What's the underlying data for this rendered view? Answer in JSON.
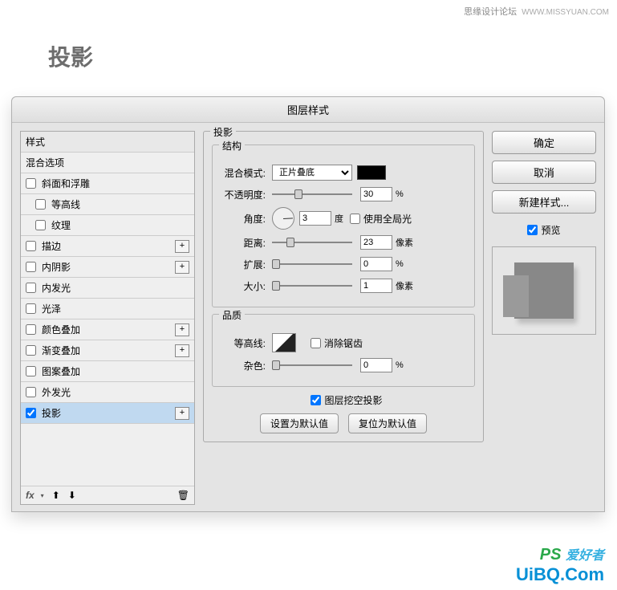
{
  "watermark": {
    "text": "思缘设计论坛",
    "url": "WWW.MISSYUAN.COM"
  },
  "page_title": "投影",
  "dialog": {
    "title": "图层样式",
    "left": {
      "header": "样式",
      "blend_options": "混合选项",
      "items": [
        {
          "label": "斜面和浮雕",
          "checked": false,
          "plus": false,
          "indent": 0
        },
        {
          "label": "等高线",
          "checked": false,
          "plus": false,
          "indent": 1
        },
        {
          "label": "纹理",
          "checked": false,
          "plus": false,
          "indent": 1
        },
        {
          "label": "描边",
          "checked": false,
          "plus": true,
          "indent": 0
        },
        {
          "label": "内阴影",
          "checked": false,
          "plus": true,
          "indent": 0
        },
        {
          "label": "内发光",
          "checked": false,
          "plus": false,
          "indent": 0
        },
        {
          "label": "光泽",
          "checked": false,
          "plus": false,
          "indent": 0
        },
        {
          "label": "颜色叠加",
          "checked": false,
          "plus": true,
          "indent": 0
        },
        {
          "label": "渐变叠加",
          "checked": false,
          "plus": true,
          "indent": 0
        },
        {
          "label": "图案叠加",
          "checked": false,
          "plus": false,
          "indent": 0
        },
        {
          "label": "外发光",
          "checked": false,
          "plus": false,
          "indent": 0
        },
        {
          "label": "投影",
          "checked": true,
          "plus": true,
          "indent": 0,
          "selected": true
        }
      ]
    },
    "center": {
      "legend": "投影",
      "structure_legend": "结构",
      "blend_mode": {
        "label": "混合模式:",
        "value": "正片叠底"
      },
      "opacity": {
        "label": "不透明度:",
        "value": "30",
        "unit": "%"
      },
      "angle": {
        "label": "角度:",
        "value": "3",
        "unit": "度"
      },
      "global_light": {
        "label": "使用全局光",
        "checked": false
      },
      "distance": {
        "label": "距离:",
        "value": "23",
        "unit": "像素"
      },
      "spread": {
        "label": "扩展:",
        "value": "0",
        "unit": "%"
      },
      "size": {
        "label": "大小:",
        "value": "1",
        "unit": "像素"
      },
      "quality_legend": "品质",
      "contour": {
        "label": "等高线:"
      },
      "antialias": {
        "label": "消除锯齿",
        "checked": false
      },
      "noise": {
        "label": "杂色:",
        "value": "0",
        "unit": "%"
      },
      "knockout": {
        "label": "图层挖空投影",
        "checked": true
      },
      "btn_default": "设置为默认值",
      "btn_reset": "复位为默认值"
    },
    "right": {
      "ok": "确定",
      "cancel": "取消",
      "new_style": "新建样式...",
      "preview": {
        "label": "预览",
        "checked": true
      }
    }
  },
  "brand": {
    "ps": "PS",
    "cn": "爱好者",
    "site": "UiBQ.Com"
  }
}
